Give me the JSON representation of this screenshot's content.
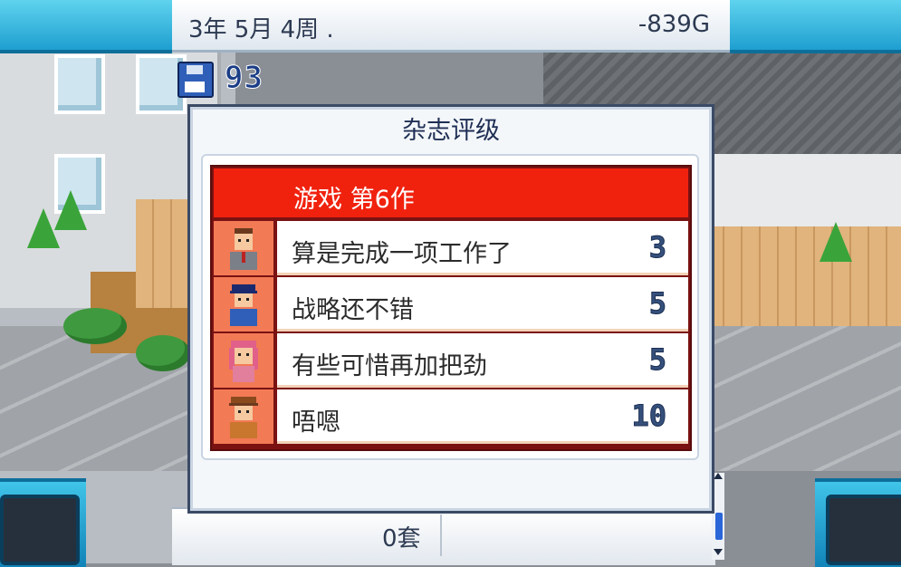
{
  "topbar": {
    "date": "3年 5月 4周 .",
    "money": "-839G"
  },
  "save": {
    "count": "93"
  },
  "dialog": {
    "title": "杂志评级",
    "game_label": "游戏 第6作",
    "reviews": [
      {
        "comment": "算是完成一项工作了",
        "score": "3",
        "reviewer_icon": "reviewer-1-icon",
        "hair": "#6b3a1e",
        "shirt": "#7a7f88"
      },
      {
        "comment": "战略还不错",
        "score": "5",
        "reviewer_icon": "reviewer-2-icon",
        "hair": "#1b2a6e",
        "shirt": "#2f5fb8"
      },
      {
        "comment": "有些可惜再加把劲",
        "score": "5",
        "reviewer_icon": "reviewer-3-icon",
        "hair": "#e0608a",
        "shirt": "#e27f9c"
      },
      {
        "comment": "唔嗯",
        "score": "10",
        "reviewer_icon": "reviewer-4-icon",
        "hair": "#8a4a1e",
        "shirt": "#c9762e"
      }
    ]
  },
  "bottom": {
    "sets": "0套"
  },
  "colors": {
    "header_red": "#f0220e",
    "portrait_bg": "#f27a55",
    "topbar_cyan": "#1e9fd0",
    "score_blue": "#35507a"
  }
}
